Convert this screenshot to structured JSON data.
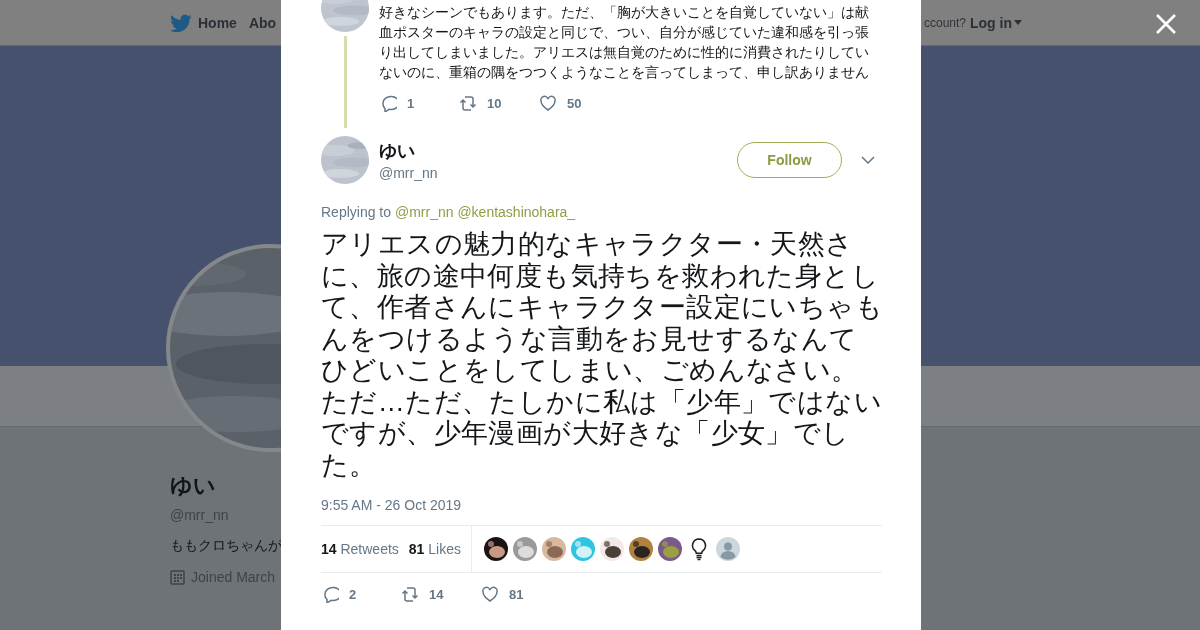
{
  "header": {
    "nav": [
      {
        "kind": "home",
        "label": "Home"
      },
      {
        "kind": "link",
        "label": "Abo"
      }
    ],
    "account_prompt": "ccount?",
    "login": "Log in"
  },
  "profile": {
    "name": "ゆい",
    "handle": "@mrr_nn",
    "bio": "ももクロちゃんが",
    "joined": "Joined March"
  },
  "dialog": {
    "previous_tweet": {
      "text": "好きなシーンでもあります。ただ、「胸が大きいことを自覚していない」は献血ポスターのキャラの設定と同じで、つい、自分が感じていた違和感を引っ張り出してしまいました。アリエスは無自覚のために性的に消費されたりしていないのに、重箱の隅をつつくようなことを言ってしまって、申し訳ありません",
      "replies": "1",
      "retweets": "10",
      "likes": "50"
    },
    "tweet": {
      "name": "ゆい",
      "handle": "@mrr_nn",
      "follow": "Follow",
      "replying_label": "Replying to",
      "replying_to": [
        "@mrr_nn",
        "@kentashinohara_"
      ],
      "text": [
        "アリエスの魅力的なキャラクター・天然さに、旅の途中何度も気持ちを救われた身として、作者さんにキャラクター設定にいちゃもんをつけるような言動をお見せするなんてひどいことをしてしまい、ごめんなさい。",
        "ただ…ただ、たしかに私は「少年」ではないですが、少年漫画が大好きな「少女」でした。"
      ],
      "time": "9:55 AM - 26 Oct 2019",
      "retweet_count": "14",
      "retweet_label": "Retweets",
      "like_count": "81",
      "like_label": "Likes",
      "likers": [
        {
          "kind": "picture"
        },
        {
          "kind": "picture"
        },
        {
          "kind": "picture"
        },
        {
          "kind": "picture"
        },
        {
          "kind": "picture"
        },
        {
          "kind": "picture"
        },
        {
          "kind": "picture"
        },
        {
          "kind": "bulb"
        },
        {
          "kind": "default"
        }
      ],
      "replies": "2",
      "retweets": "14",
      "likes": "81"
    }
  }
}
